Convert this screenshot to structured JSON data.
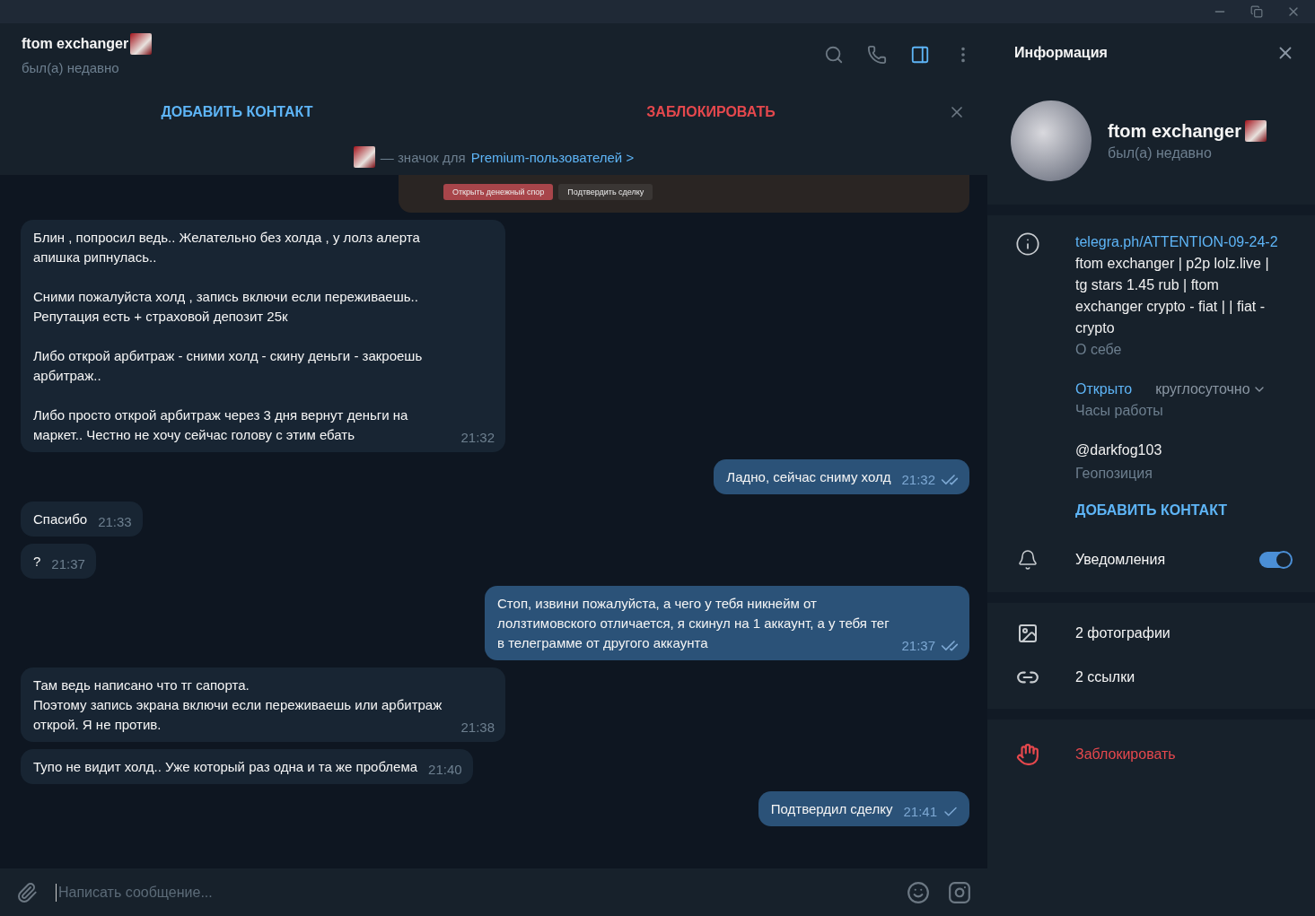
{
  "chat_header": {
    "name": "ftom exchanger",
    "status": "был(а) недавно"
  },
  "action_bar": {
    "add_contact": "ДОБАВИТЬ КОНТАКТ",
    "block": "ЗАБЛОКИРОВАТЬ"
  },
  "premium_notice": {
    "text": "— значок для",
    "link": "Premium-пользователей >"
  },
  "messages": [
    {
      "kind": "card",
      "buttons": [
        {
          "label": "Открыть денежный спор",
          "kind": "danger"
        },
        {
          "label": "Подтвердить сделку",
          "kind": "plain"
        }
      ]
    },
    {
      "kind": "incoming",
      "paragraphs": [
        "Блин , попросил ведь.. Желательно без холда , у лолз алерта апишка рипнулась..",
        "Сними пожалуйста холд , запись включи если переживаешь.. Репутация есть + страховой депозит 25к",
        "Либо открой арбитраж - сними холд - скину деньги - закроешь арбитраж..",
        "Либо просто открой арбитраж через 3 дня вернут деньги на маркет.. Честно не хочу сейчас голову с этим ебать"
      ],
      "time": "21:32"
    },
    {
      "kind": "outgoing",
      "paragraphs": [
        "Ладно, сейчас сниму холд"
      ],
      "time": "21:32",
      "read": true
    },
    {
      "kind": "incoming",
      "paragraphs": [
        "Спасибо"
      ],
      "time": "21:33"
    },
    {
      "kind": "incoming",
      "paragraphs": [
        "?"
      ],
      "time": "21:37"
    },
    {
      "kind": "outgoing",
      "paragraphs": [
        "Стоп, извини пожалуйста, а чего у тебя никнейм от лолзтимовского отличается, я скинул на 1 аккаунт, а у тебя тег в телеграмме от другого аккаунта"
      ],
      "time": "21:37",
      "read": true
    },
    {
      "kind": "incoming",
      "paragraphs": [
        "Там ведь написано что тг сапорта.\nПоэтому запись экрана включи если переживаешь или арбитраж открой. Я не против."
      ],
      "time": "21:38"
    },
    {
      "kind": "incoming",
      "paragraphs": [
        "Тупо не видит холд.. Уже который раз одна и та же проблема"
      ],
      "time": "21:40"
    },
    {
      "kind": "outgoing",
      "paragraphs": [
        "Подтвердил сделку"
      ],
      "time": "21:41",
      "read": false
    }
  ],
  "composer": {
    "placeholder": "Написать сообщение..."
  },
  "info_panel": {
    "title": "Информация",
    "name": "ftom exchanger",
    "status": "был(а) недавно",
    "bio_link": "telegra.ph/ATTENTION-09-24-2",
    "bio": "ftom exchanger | p2p lolz.live | tg stars 1.45 rub | ftom exchanger crypto - fiat | | fiat - crypto",
    "bio_label": "О себе",
    "hours_status": "Открыто",
    "hours_value": "круглосуточно",
    "hours_label": "Часы работы",
    "location": "@darkfog103",
    "location_label": "Геопозиция",
    "add_contact": "ДОБАВИТЬ КОНТАКТ",
    "notifications": {
      "label": "Уведомления",
      "on": true
    },
    "media": [
      {
        "kind": "photos",
        "label": "2 фотографии"
      },
      {
        "kind": "links",
        "label": "2 ссылки"
      }
    ],
    "block": "Заблокировать"
  }
}
